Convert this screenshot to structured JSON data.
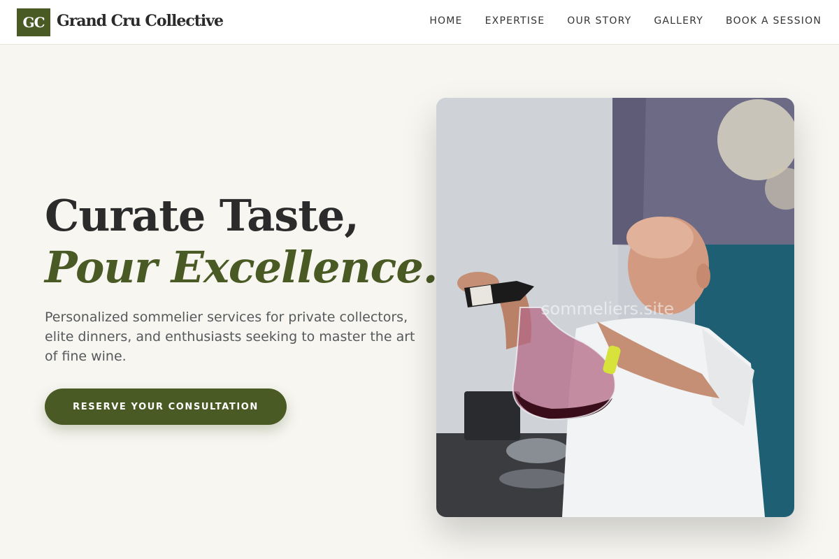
{
  "brand": {
    "mark": "GC",
    "name": "Grand Cru Collective",
    "color": "#4a5a25"
  },
  "nav": {
    "items": [
      {
        "label": "HOME"
      },
      {
        "label": "EXPERTISE"
      },
      {
        "label": "OUR STORY"
      },
      {
        "label": "GALLERY"
      },
      {
        "label": "BOOK A SESSION"
      }
    ]
  },
  "hero": {
    "headline_line1": "Curate Taste,",
    "headline_line2": "Pour Excellence.",
    "subtext": "Personalized sommelier services for private collectors, elite dinners, and enthusiasts seeking to master the art of fine wine.",
    "cta_label": "RESERVE YOUR CONSULTATION",
    "image": {
      "watermark": "sommeliers.site"
    }
  }
}
